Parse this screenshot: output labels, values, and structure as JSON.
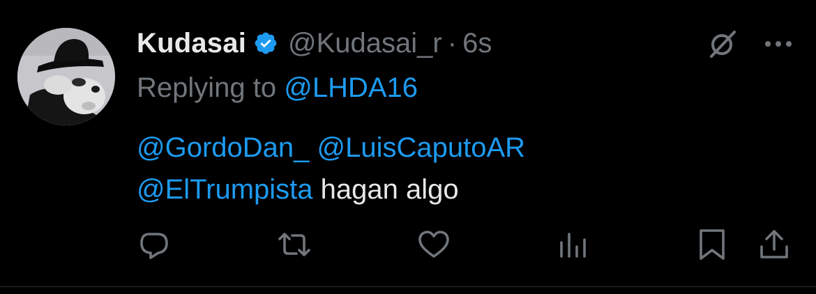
{
  "author": {
    "display_name": "Kudasai",
    "verified": true,
    "handle": "@Kudasai_r",
    "separator": "·",
    "time": "6s"
  },
  "reply": {
    "prefix": "Replying to ",
    "to": "@LHDA16"
  },
  "content": {
    "mention_1": "@GordoDan_",
    "mention_2": "@LuisCaputoAR",
    "mention_3": "@ElTrumpista",
    "text": "hagan algo"
  },
  "actions": [
    "reply",
    "retweet",
    "like",
    "views",
    "bookmark",
    "share"
  ],
  "colors": {
    "background": "#000000",
    "primary_text": "#e7e9ea",
    "secondary_text": "#71767b",
    "link": "#1d9bf0",
    "verified_badge": "#1d9bf0",
    "divider": "#2f3336"
  }
}
